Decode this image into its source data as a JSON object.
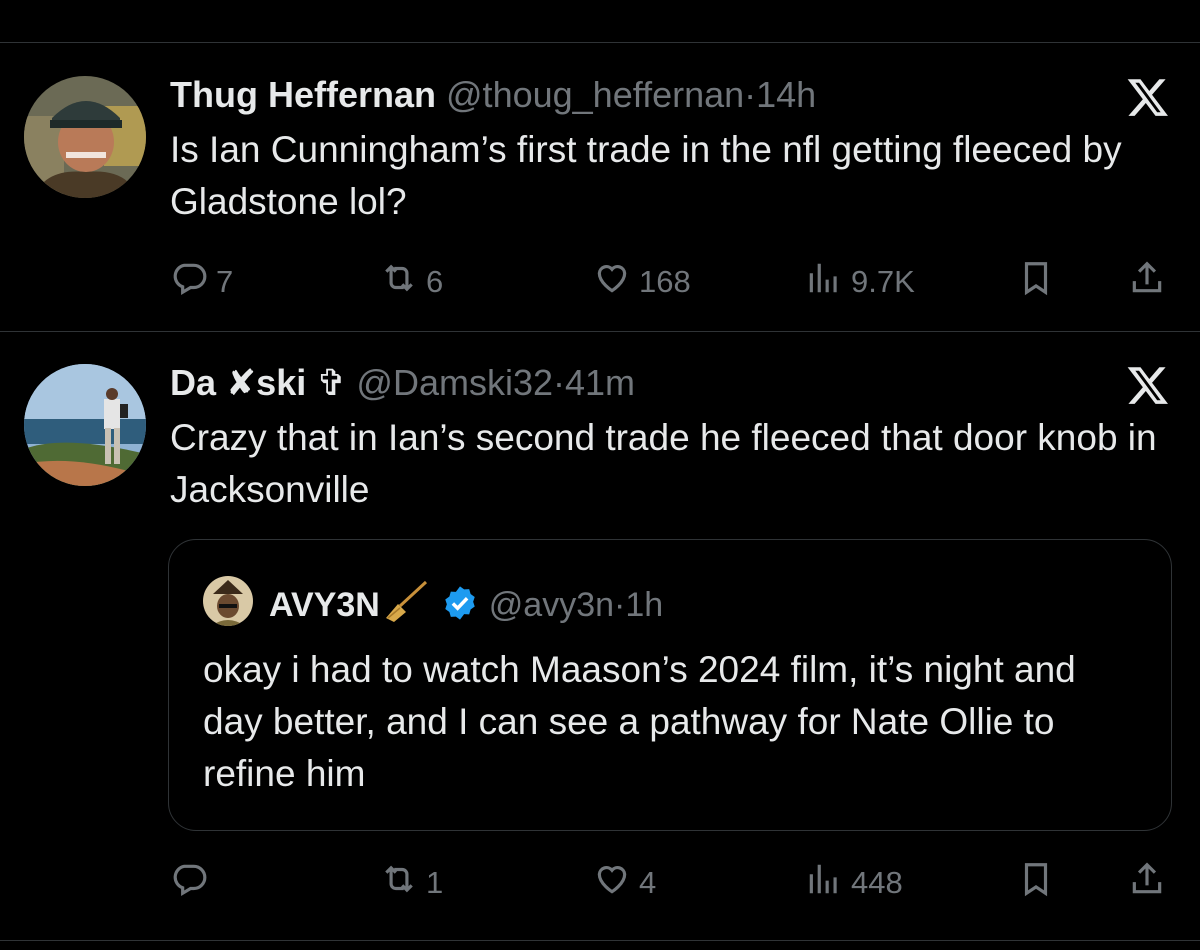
{
  "tweets": [
    {
      "name": "Thug Heffernan",
      "handle": "@thoug_heffernan",
      "separator": "·",
      "time": "14h",
      "text": "Is Ian Cunningham’s first trade in the nfl getting fleeced by Gladstone lol?",
      "replies": "7",
      "reposts": "6",
      "likes": "168",
      "views": "9.7K"
    },
    {
      "name": "Da ✘ski ✞",
      "handle": "@Damski32",
      "separator": "·",
      "time": "41m",
      "text": "Crazy that in Ian’s second trade he fleeced that door knob in Jacksonville",
      "replies": "",
      "reposts": "1",
      "likes": "4",
      "views": "448",
      "quote": {
        "name": "AVY3N",
        "handle": "@avy3n",
        "separator": "·",
        "time": "1h",
        "text": "okay i had to watch Maason’s 2024 film, it’s night and day better, and I can see a pathway for Nate Ollie to refine him"
      }
    }
  ],
  "colors": {
    "background": "#000000",
    "text": "#e7e9ea",
    "muted": "#71767b",
    "divider": "#2f3336",
    "verified": "#1d9bf0"
  },
  "icons": [
    "reply-icon",
    "repost-icon",
    "like-icon",
    "views-icon",
    "bookmark-icon",
    "share-icon",
    "x-logo-icon",
    "verified-badge-icon",
    "broom-icon"
  ]
}
